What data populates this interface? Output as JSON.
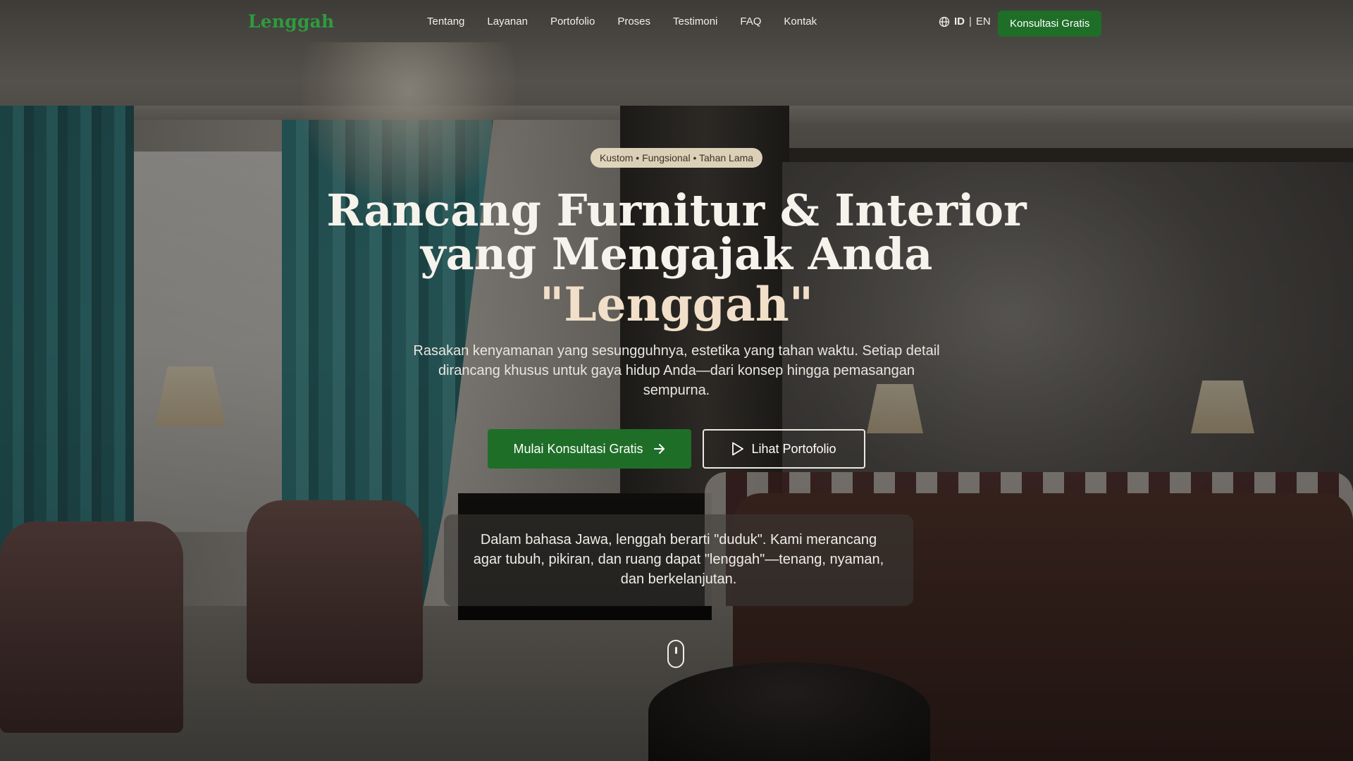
{
  "brand": {
    "logo_text": "Lenggah",
    "logo_color": "#2e9b3e",
    "accent_green": "#1f6e28"
  },
  "nav": {
    "links": [
      "Tentang",
      "Layanan",
      "Portofolio",
      "Proses",
      "Testimoni",
      "FAQ",
      "Kontak"
    ],
    "language": {
      "icon": "globe-icon",
      "active": "ID",
      "separator": "|",
      "other": "EN"
    },
    "cta_label": "Konsultasi Gratis"
  },
  "hero": {
    "badge": "Kustom • Fungsional • Tahan Lama",
    "headline_line1": "Rancang Furnitur & Interior",
    "headline_line2": "yang Mengajak Anda",
    "headline_accent": "\"Lenggah\"",
    "subtitle": "Rasakan kenyamanan yang sesungguhnya, estetika yang tahan waktu. Setiap detail dirancang khusus untuk gaya hidup Anda—dari konsep hingga pemasangan sempurna.",
    "primary_button": {
      "label": "Mulai Konsultasi Gratis",
      "icon": "arrow-right-icon"
    },
    "secondary_button": {
      "label": "Lihat Portofolio",
      "icon": "play-icon"
    },
    "note": "Dalam bahasa Jawa, lenggah berarti \"duduk\". Kami merancang agar tubuh, pikiran, dan ruang dapat \"lenggah\"—tenang, nyaman, dan berkelanjutan.",
    "scroll_indicator": "mouse-scroll-icon"
  }
}
